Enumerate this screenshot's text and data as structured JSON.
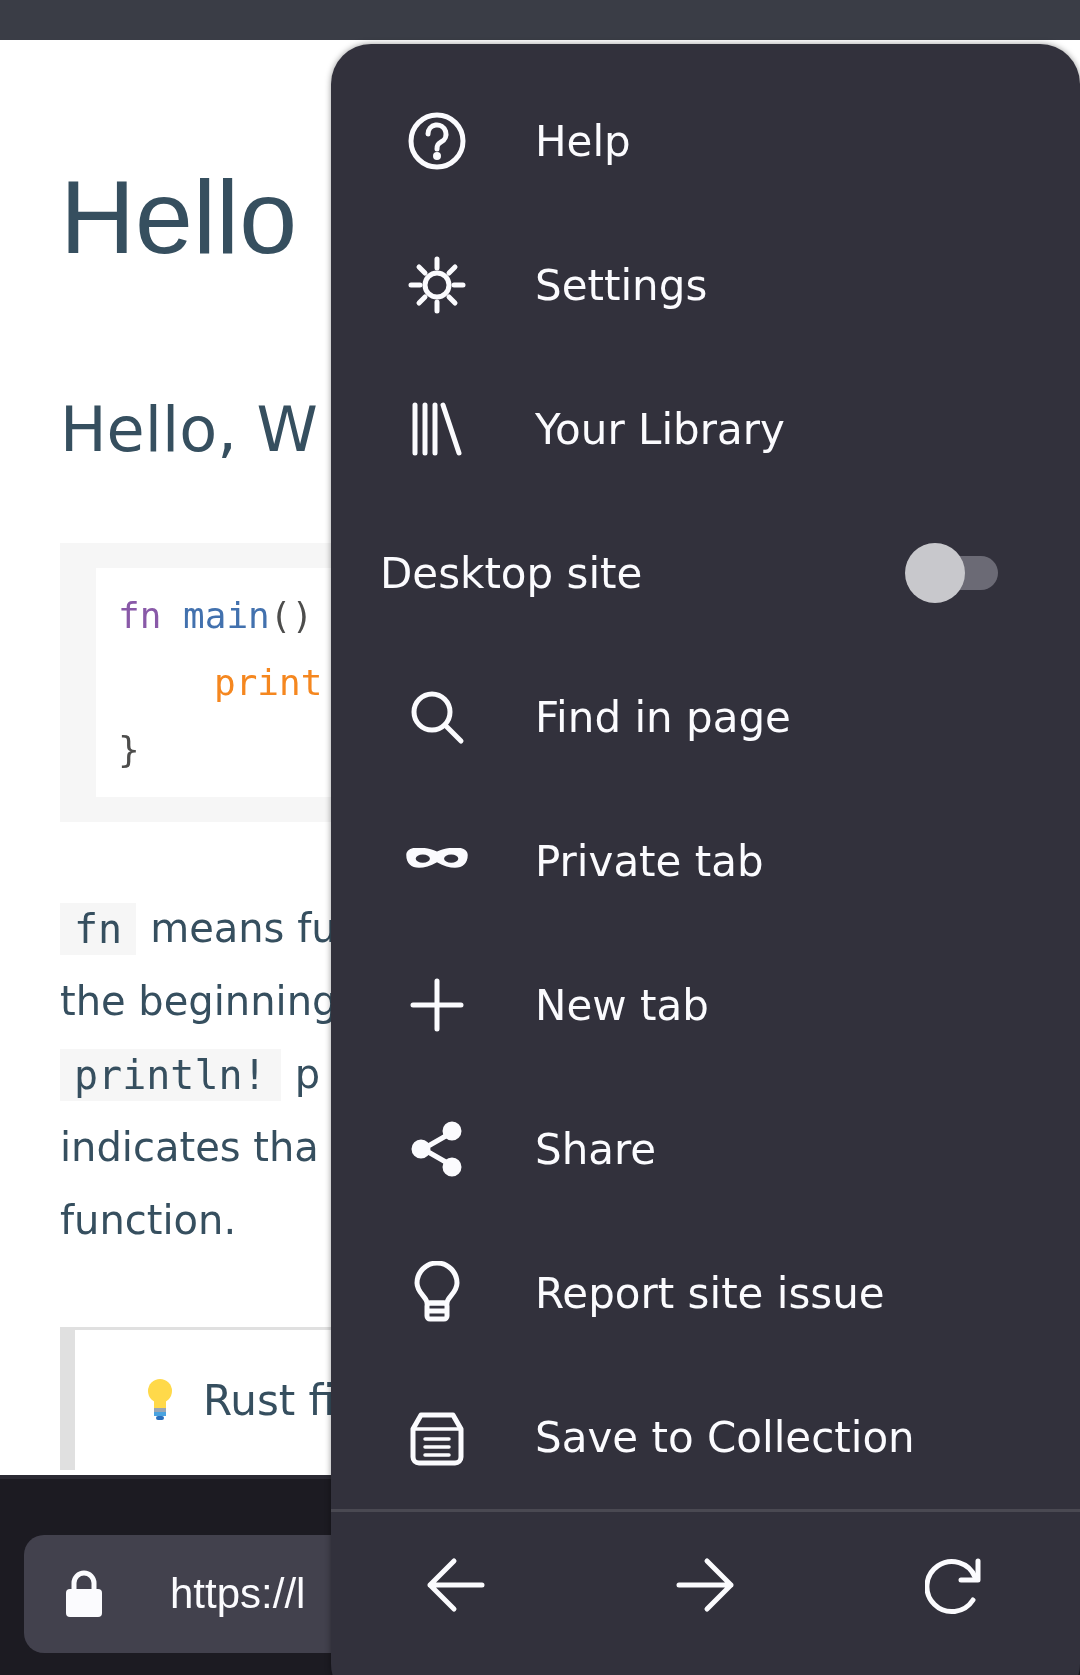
{
  "page": {
    "heading": "Hello",
    "subheading": "Hello, W",
    "code_lines": [
      {
        "indent": false,
        "tokens": [
          {
            "text": "fn ",
            "color": "#8959a8"
          },
          {
            "text": "main",
            "color": "#4271ae"
          },
          {
            "text": "()",
            "color": "#4d4d4c"
          }
        ]
      },
      {
        "indent": true,
        "tokens": [
          {
            "text": "print",
            "color": "#f5871f"
          }
        ]
      },
      {
        "indent": false,
        "tokens": [
          {
            "text": "}",
            "color": "#4d4d4c"
          }
        ]
      }
    ],
    "paragraph_lines": [
      {
        "code": "fn",
        "text": "means fu"
      },
      {
        "text": "the beginning"
      },
      {
        "code": "println!",
        "text": "p"
      },
      {
        "text": "indicates tha"
      },
      {
        "text": "function."
      }
    ],
    "tip": {
      "text": "Rust fi"
    }
  },
  "address_bar": {
    "url": "https://l"
  },
  "menu": {
    "items": [
      {
        "kind": "link",
        "label": "Help"
      },
      {
        "kind": "link",
        "label": "Settings"
      },
      {
        "kind": "link",
        "label": "Your Library"
      },
      {
        "kind": "toggle",
        "label": "Desktop site",
        "on": false
      },
      {
        "kind": "link",
        "label": "Find in page"
      },
      {
        "kind": "link",
        "label": "Private tab"
      },
      {
        "kind": "link",
        "label": "New tab"
      },
      {
        "kind": "link",
        "label": "Share"
      },
      {
        "kind": "link",
        "label": "Report site issue"
      },
      {
        "kind": "link",
        "label": "Save to Collection"
      }
    ]
  }
}
